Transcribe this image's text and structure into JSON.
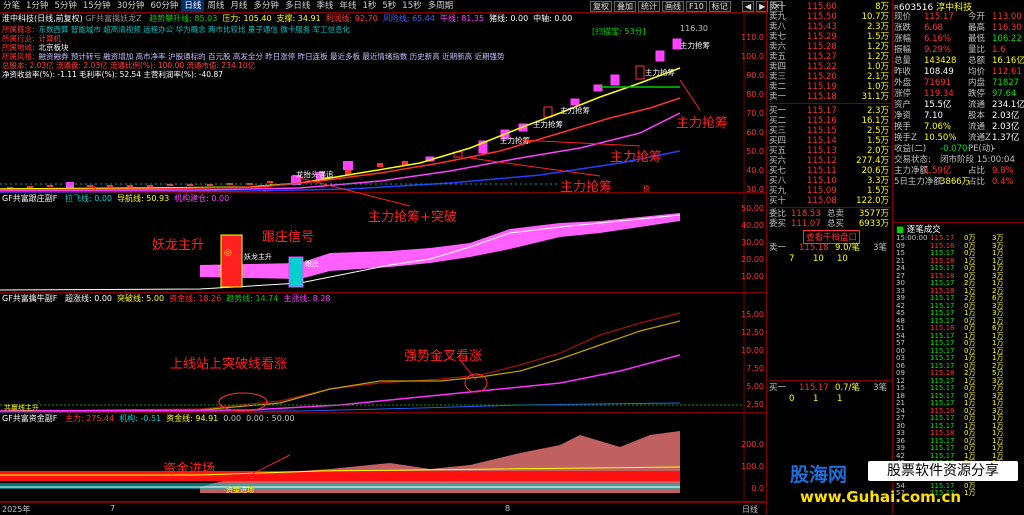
{
  "toolbar": {
    "tabs": [
      "分笔",
      "1分钟",
      "5分钟",
      "15分钟",
      "30分钟",
      "60分钟",
      "日线",
      "周线",
      "月线",
      "多分钟",
      "多日线",
      "季线",
      "年线",
      "1秒",
      "5秒",
      "15秒",
      "多周期"
    ],
    "selected": "日线",
    "buttons": [
      "复权",
      "叠加",
      "统计",
      "画线",
      "F10",
      "标记"
    ],
    "window_buttons": [
      "◀",
      "▶",
      "✕"
    ]
  },
  "main_chart": {
    "title_left": "淮中科技(日线,前复权)",
    "indicator": "GF共富擒妖龙Z",
    "legend": [
      {
        "t": "趋势攀升线: 85.03",
        "c": "#00d000"
      },
      {
        "t": "压力: 105.40",
        "c": "#ffff00"
      },
      {
        "t": "支撑: 34.91",
        "c": "#ffff00"
      },
      {
        "t": "利润线: 92.70",
        "c": "#ff4040"
      },
      {
        "t": "风险线: 65.44",
        "c": "#4060ff"
      },
      {
        "t": "牛线: 81.35",
        "c": "#ff40ff"
      },
      {
        "t": "猪线: 0.00",
        "c": "#ffffff"
      },
      {
        "t": "中轴: 0.00",
        "c": "#ffffff"
      }
    ],
    "info_lines": [
      {
        "label": "所属概念:",
        "text": "东数西算 智能城市 超高清视频 远程办公 华为概念 两市比较比 量子通信 微卡服务 军工信息化",
        "lc": "#ff3030",
        "tc": "#00c0c0"
      },
      {
        "label": "所属行业:",
        "text": "计算机",
        "lc": "#ff3030",
        "tc": "#ff3030"
      },
      {
        "label": "所属地域:",
        "text": "北京板块",
        "lc": "#ff3030",
        "tc": "#ffffff"
      },
      {
        "label": "所属风格:",
        "text": "融资融券 预计转亏 融资增加 高市净率 沪股通标的 百元股 高发全分 昨日涨停 昨日连板 最近多板 最近情绪指数 历史新高 近期新高 近期强势",
        "lc": "#ff3030",
        "tc": "#c0c0ff"
      },
      {
        "label": "",
        "text": "总股本: 2.03亿  流通盘: 2.03亿  流通比例(%): 100.00  流通市值: 234.10亿",
        "lc": "#ff3030",
        "tc": "#ff4040"
      },
      {
        "label": "",
        "text": "净资收益率(%): -1.11  毛利率(%): 52.54  主营利润率(%): -40.87",
        "lc": "#ffffff",
        "tc": "#ffffff"
      }
    ],
    "y_ticks": [
      "110.0",
      "100.0",
      "90.0",
      "80.0",
      "70.0",
      "60.0",
      "50.0",
      "40.0",
      "30.0"
    ],
    "price_high": "116.30",
    "scan_label": "[扫描宝: 53分]",
    "markers": [
      "主力抢筹",
      "主力抢筹",
      "主力抢筹",
      "主力抢筹",
      "主力抢筹",
      "龙抬头强追"
    ],
    "date_markers": [
      "9",
      "条",
      "稳"
    ]
  },
  "panel2": {
    "indicator": "GF共富跟庄副F",
    "legend": [
      "拉飞线: 0.00",
      "导航线: 50.93",
      "机构建仓: 0.00"
    ],
    "y_ticks": [
      "50.00",
      "40.00",
      "30.00",
      "20.00",
      "10.00"
    ],
    "labels": [
      "妖龙主升",
      "跟庄"
    ]
  },
  "panel3": {
    "indicator": "GF共富擒牛副F",
    "legend": [
      "超涨线: 0.00",
      "突破线: 5.00",
      "资金线: 18.26",
      "趋势线: 14.74",
      "主涨线: 8.28"
    ],
    "y_ticks": [
      "15.00",
      "12.50",
      "10.00",
      "7.50",
      "5.00",
      "2.50"
    ],
    "labels": [
      "共赢线主升"
    ]
  },
  "panel4": {
    "indicator": "GF共富资金副F",
    "legend": [
      "主力: 275.44",
      "机构: -0.51",
      "资金线: 94.91",
      "0.00",
      "0.00 : 50.00"
    ],
    "y_ticks": [
      "200.0",
      "100.0",
      "0.0"
    ],
    "labels": [
      "资金进场"
    ]
  },
  "date_axis": {
    "labels": [
      "2025年",
      "7",
      "8"
    ],
    "right_label": "日线"
  },
  "annotations": [
    {
      "text": "主力抢筹",
      "color": "#ff2020"
    },
    {
      "text": "主力抢筹",
      "color": "#ff2020"
    },
    {
      "text": "主力抢筹",
      "color": "#ff2020"
    },
    {
      "text": "主力抢筹+突破",
      "color": "#ff2020"
    },
    {
      "text": "妖龙主升",
      "color": "#ff2020"
    },
    {
      "text": "跟庄信号",
      "color": "#ff2020"
    },
    {
      "text": "上线站上突破线看涨",
      "color": "#ff2020"
    },
    {
      "text": "强势金叉看涨",
      "color": "#ff2020"
    },
    {
      "text": "资金进场",
      "color": "#ff2020"
    }
  ],
  "orderbook": {
    "sells": [
      {
        "l": "卖十",
        "p": "115.60",
        "v": "8万"
      },
      {
        "l": "卖九",
        "p": "115.50",
        "v": "10.7万"
      },
      {
        "l": "卖八",
        "p": "115.43",
        "v": "2.3万"
      },
      {
        "l": "卖七",
        "p": "115.29",
        "v": "1.5万"
      },
      {
        "l": "卖六",
        "p": "115.28",
        "v": "1.2万"
      },
      {
        "l": "卖五",
        "p": "115.27",
        "v": "1.2万"
      },
      {
        "l": "卖四",
        "p": "115.22",
        "v": "1.0万"
      },
      {
        "l": "卖三",
        "p": "115.20",
        "v": "2.1万"
      },
      {
        "l": "卖二",
        "p": "115.19",
        "v": "1.0万"
      },
      {
        "l": "卖一",
        "p": "115.18",
        "v": "31.1万"
      }
    ],
    "buys": [
      {
        "l": "买一",
        "p": "115.17",
        "v": "2.3万"
      },
      {
        "l": "买二",
        "p": "115.16",
        "v": "16.1万"
      },
      {
        "l": "买三",
        "p": "115.15",
        "v": "2.5万"
      },
      {
        "l": "买四",
        "p": "115.14",
        "v": "1.5万"
      },
      {
        "l": "买五",
        "p": "115.13",
        "v": "2.0万"
      },
      {
        "l": "买六",
        "p": "115.12",
        "v": "277.4万"
      },
      {
        "l": "买七",
        "p": "115.11",
        "v": "20.6万"
      },
      {
        "l": "买八",
        "p": "115.10",
        "v": "3.3万"
      },
      {
        "l": "买九",
        "p": "115.09",
        "v": "1.5万"
      },
      {
        "l": "买十",
        "p": "115.08",
        "v": "122.0万"
      }
    ],
    "weibi": {
      "l1": "委比",
      "v1": "118.53",
      "l2": "总卖",
      "v2": "3577万"
    },
    "weicha": {
      "l1": "委买",
      "v1": "111.07",
      "l2": "总买",
      "v2": "6933万"
    },
    "link": "查看千档盘口",
    "q1": {
      "a": "卖一",
      "b": "115.18",
      "c": "9.0/笔",
      "d": "3笔",
      "e": "7",
      "f": "10",
      "g": "10"
    },
    "q2": {
      "a": "买一",
      "b": "115.17",
      "c": "0.7/笔",
      "d": "3笔",
      "e": "0",
      "f": "1",
      "g": "1"
    }
  },
  "quote": {
    "code": "603516",
    "name": "淳中科技",
    "rows": [
      {
        "a": "现价",
        "b": "115.17",
        "c": "今开",
        "d": "113.00",
        "bc": "#ff3030",
        "dc": "#ff3030"
      },
      {
        "a": "涨跌",
        "b": "6.68",
        "c": "最高",
        "d": "116.30",
        "bc": "#ff3030",
        "dc": "#ff3030"
      },
      {
        "a": "涨幅",
        "b": "6.16%",
        "c": "最低",
        "d": "106.22",
        "bc": "#ff3030",
        "dc": "#00e000"
      },
      {
        "a": "振幅",
        "b": "9.29%",
        "c": "量比",
        "d": "1.6",
        "bc": "#ff3030",
        "dc": "#ff3030"
      },
      {
        "a": "总量",
        "b": "143428",
        "c": "总额",
        "d": "16.16亿",
        "bc": "#ffff00",
        "dc": "#ffff00"
      },
      {
        "a": "昨收",
        "b": "108.49",
        "c": "均价",
        "d": "112.61",
        "bc": "#ffffff",
        "dc": "#ff3030"
      },
      {
        "a": "外盘",
        "b": "71691",
        "c": "内盘",
        "d": "71827",
        "bc": "#ff3030",
        "dc": "#00e000"
      },
      {
        "a": "涨停",
        "b": "119.34",
        "c": "跌停",
        "d": "97.64",
        "bc": "#ff3030",
        "dc": "#00e000"
      },
      {
        "a": "资产",
        "b": "15.5亿",
        "c": "流通",
        "d": "234.1亿",
        "bc": "#ffffff",
        "dc": "#ffffff"
      },
      {
        "a": "净资",
        "b": "7.10",
        "c": "股本",
        "d": "2.03亿",
        "bc": "#ffffff",
        "dc": "#ffffff"
      },
      {
        "a": "换手",
        "b": "7.06%",
        "c": "流通",
        "d": "2.03亿",
        "bc": "#ffff00",
        "dc": "#ffffff"
      },
      {
        "a": "换手Z",
        "b": "10.50%",
        "c": "流通Z",
        "d": "1.37亿",
        "bc": "#ffff00",
        "dc": "#ffffff"
      },
      {
        "a": "收益(二)",
        "b": "-0.070",
        "c": "PE(动)",
        "d": "-",
        "bc": "#00e000",
        "dc": "#ffffff"
      },
      {
        "a": "交易状态:",
        "b": "闭市阶段 15:00:04",
        "c": "",
        "d": "",
        "bc": "#c0c0c0",
        "dc": "#c0c0c0"
      },
      {
        "a": "主力净额",
        "b": "1.59亿",
        "c": "占比",
        "d": "9.8%",
        "bc": "#ff3030",
        "dc": "#ff3030"
      },
      {
        "a": "5日主力净额",
        "b": "3866万",
        "c": "占比",
        "d": "0.4%",
        "bc": "#ffff00",
        "dc": "#ff3030"
      }
    ],
    "side_values": [
      "11.3",
      "11.1",
      "11.0",
      "11.0"
    ]
  },
  "ticks": {
    "header": "逐笔成交",
    "rows": [
      {
        "t": "15:00:00",
        "p": "115.17",
        "v": "0万",
        "c": "#ff3030"
      },
      {
        "t": "09",
        "p": "115.18",
        "v": "0万",
        "c": "#ff3030"
      },
      {
        "t": "15",
        "p": "115.17",
        "v": "0万",
        "c": "#00e000"
      },
      {
        "t": "21",
        "p": "115.18",
        "v": "1万",
        "c": "#ff3030"
      },
      {
        "t": "24",
        "p": "115.17",
        "v": "0万",
        "c": "#00e000"
      },
      {
        "t": "27",
        "p": "115.18",
        "v": "0万",
        "c": "#ff3030"
      },
      {
        "t": "30",
        "p": "115.17",
        "v": "2万",
        "c": "#00e000"
      },
      {
        "t": "33",
        "p": "115.18",
        "v": "1万",
        "c": "#ff3030"
      },
      {
        "t": "39",
        "p": "115.17",
        "v": "2万",
        "c": "#00e000"
      },
      {
        "t": "42",
        "p": "115.17",
        "v": "0万",
        "c": "#00e000"
      },
      {
        "t": "45",
        "p": "115.17",
        "v": "1万",
        "c": "#00e000"
      },
      {
        "t": "48",
        "p": "115.17",
        "v": "0万",
        "c": "#00e000"
      },
      {
        "t": "51",
        "p": "115.18",
        "v": "0万",
        "c": "#ff3030"
      },
      {
        "t": "54",
        "p": "115.17",
        "v": "1万",
        "c": "#00e000"
      },
      {
        "t": "57",
        "p": "115.17",
        "v": "0万",
        "c": "#00e000"
      },
      {
        "t": "00",
        "p": "115.17",
        "v": "0万",
        "c": "#00e000"
      },
      {
        "t": "03",
        "p": "115.17",
        "v": "1万",
        "c": "#00e000"
      },
      {
        "t": "06",
        "p": "115.17",
        "v": "0万",
        "c": "#00e000"
      },
      {
        "t": "09",
        "p": "115.18",
        "v": "2万",
        "c": "#ff3030"
      },
      {
        "t": "12",
        "p": "115.17",
        "v": "1万",
        "c": "#00e000"
      },
      {
        "t": "15",
        "p": "115.17",
        "v": "0万",
        "c": "#00e000"
      },
      {
        "t": "18",
        "p": "115.17",
        "v": "0万",
        "c": "#00e000"
      },
      {
        "t": "21",
        "p": "115.17",
        "v": "1万",
        "c": "#00e000"
      },
      {
        "t": "24",
        "p": "115.18",
        "v": "0万",
        "c": "#ff3030"
      },
      {
        "t": "27",
        "p": "115.17",
        "v": "0万",
        "c": "#00e000"
      },
      {
        "t": "30",
        "p": "115.17",
        "v": "1万",
        "c": "#00e000"
      },
      {
        "t": "33",
        "p": "115.18",
        "v": "0万",
        "c": "#ff3030"
      },
      {
        "t": "36",
        "p": "115.17",
        "v": "0万",
        "c": "#00e000"
      },
      {
        "t": "39",
        "p": "115.17",
        "v": "0万",
        "c": "#00e000"
      },
      {
        "t": "42",
        "p": "115.17",
        "v": "1万",
        "c": "#00e000"
      },
      {
        "t": "45",
        "p": "115.17",
        "v": "2万",
        "c": "#00e000"
      },
      {
        "t": "48",
        "p": "115.17",
        "v": "0万",
        "c": "#00e000"
      },
      {
        "t": "51",
        "p": "115.17",
        "v": "0万",
        "c": "#00e000"
      },
      {
        "t": "54",
        "p": "115.17",
        "v": "0万",
        "c": "#00e000"
      },
      {
        "t": "57",
        "p": "115.17",
        "v": "1万",
        "c": "#00e000"
      },
      {
        "t": "59",
        "p": "115.17",
        "v": "1万",
        "c": "#00e000"
      }
    ],
    "right_vols": [
      "3万",
      "3万",
      "1万",
      "1万",
      "1万",
      "3万",
      "1万",
      "2万",
      "6万",
      "3万",
      "3万",
      "1万",
      "6万",
      "1万",
      "1万",
      "1万",
      "1万",
      "2万",
      "5万",
      "3万",
      "7万",
      "3万",
      "1万",
      "3万",
      "1万",
      "1万",
      "1万",
      "1万",
      "1万",
      "1万",
      "1万",
      "1万"
    ],
    "side_flags": [
      "A"
    ]
  },
  "watermark": {
    "brand": "股海网",
    "slogan": "股票软件资源分享",
    "url": "www.Guhai.com.cn"
  }
}
